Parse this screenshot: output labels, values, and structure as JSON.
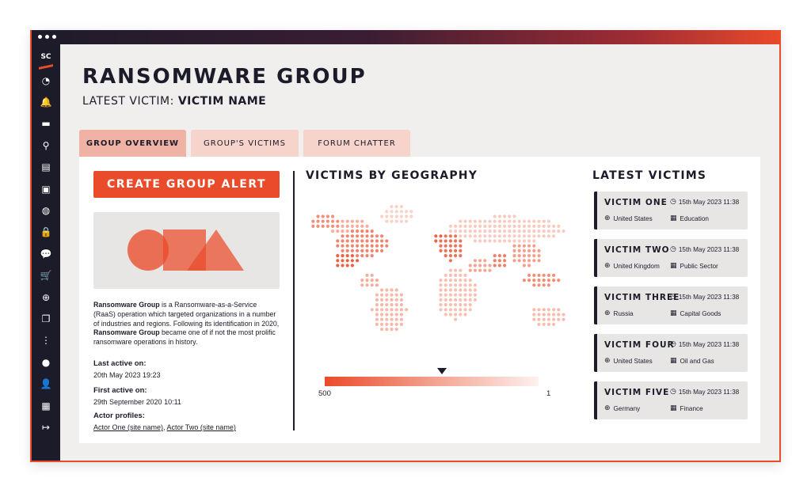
{
  "window": {
    "dots": [
      "●",
      "●",
      "●"
    ]
  },
  "sidebar": {
    "logo_text": "SC",
    "items": [
      {
        "icon": "dashboard-icon",
        "glyph": "◔"
      },
      {
        "icon": "bell-icon",
        "glyph": "🔔"
      },
      {
        "icon": "folder-icon",
        "glyph": "▬"
      },
      {
        "icon": "search-icon",
        "glyph": "⚲"
      },
      {
        "icon": "book-icon",
        "glyph": "▤"
      },
      {
        "icon": "monitor-icon",
        "glyph": "▣"
      },
      {
        "icon": "onion-icon",
        "glyph": "◍"
      },
      {
        "icon": "lock-icon",
        "glyph": "🔒"
      },
      {
        "icon": "chat-icon",
        "glyph": "💬"
      },
      {
        "icon": "cart-icon",
        "glyph": "🛒"
      },
      {
        "icon": "crosshair-icon",
        "glyph": "⊕"
      },
      {
        "icon": "documents-icon",
        "glyph": "❐"
      },
      {
        "icon": "traffic-light-icon",
        "glyph": "⋮"
      },
      {
        "icon": "speech-bubble-icon",
        "glyph": "●"
      },
      {
        "icon": "user-icon",
        "glyph": "👤"
      },
      {
        "icon": "building-icon",
        "glyph": "▦"
      },
      {
        "icon": "logout-icon",
        "glyph": "↦"
      }
    ]
  },
  "header": {
    "title": "RANSOMWARE GROUP",
    "latest_label": "LATEST VICTIM: ",
    "latest_value": "VICTIM NAME"
  },
  "tabs": [
    {
      "label": "GROUP OVERVIEW",
      "active": true
    },
    {
      "label": "GROUP'S VICTIMS",
      "active": false
    },
    {
      "label": "FORUM CHATTER",
      "active": false
    }
  ],
  "overview": {
    "alert_button": "CREATE GROUP ALERT",
    "desc_name1": "Ransomware Group",
    "desc_part1": " is a Ransomware-as-a-Service (RaaS) operation which targeted organizations in a number of industries and regions. Following its identification in 2020, ",
    "desc_name2": "Ransomware Group",
    "desc_part2": " became one of if not the most prolific ransomware operations in history.",
    "last_active_label": "Last active on:",
    "last_active_value": "20th May 2023 19:23",
    "first_active_label": "First active on:",
    "first_active_value": "29th September 2020 10:11",
    "actor_label": "Actor profiles:",
    "actor_one": "Actor One (site name)",
    "actor_sep": ", ",
    "actor_two": "Actor Two (site name)"
  },
  "geography": {
    "title": "VICTIMS BY GEOGRAPHY",
    "legend_max": "500",
    "legend_min": "1"
  },
  "latest": {
    "title": "LATEST VICTIMS",
    "victims": [
      {
        "name": "VICTIM ONE",
        "time": "15th May 2023 11:38",
        "country": "United States",
        "sector": "Education"
      },
      {
        "name": "VICTIM TWO",
        "time": "15th May 2023 11:38",
        "country": "United Kingdom",
        "sector": "Public Sector"
      },
      {
        "name": "VICTIM THREE",
        "time": "15th May 2023 11:38",
        "country": "Russia",
        "sector": "Capital Goods"
      },
      {
        "name": "VICTIM FOUR",
        "time": "15th May 2023 11:38",
        "country": "United States",
        "sector": "Oil and Gas"
      },
      {
        "name": "VICTIM FIVE",
        "time": "15th May 2023 11:38",
        "country": "Germany",
        "sector": "Finance"
      }
    ]
  },
  "colors": {
    "accent": "#ea4b2a",
    "dark": "#1c1b29",
    "tab_active": "#f0b2a4",
    "tab": "#f6d3cb"
  }
}
